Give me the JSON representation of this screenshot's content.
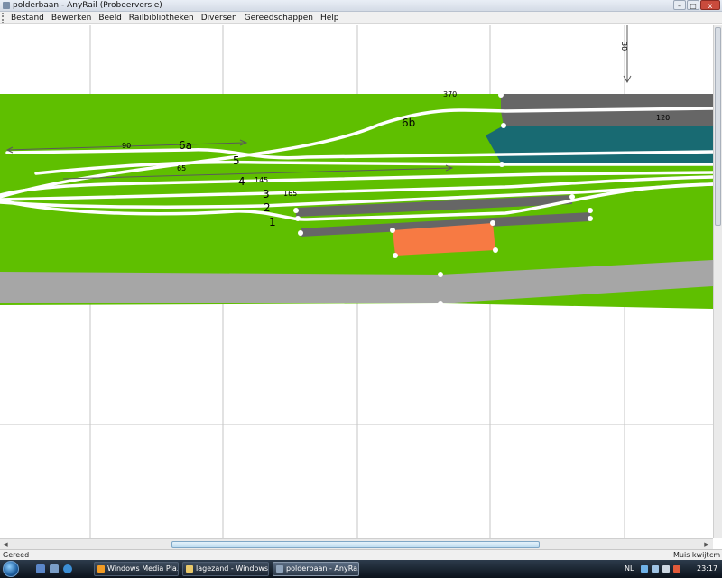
{
  "window": {
    "title": "polderbaan - AnyRail (Probeerversie)",
    "buttons": {
      "minimize": "–",
      "maximize": "□",
      "close": "x"
    }
  },
  "menu": [
    "Bestand",
    "Bewerken",
    "Beeld",
    "Railbibliotheken",
    "Diversen",
    "Gereedschappen",
    "Help"
  ],
  "layout_labels": {
    "dim_370": "370",
    "dim_120": "120",
    "dim_90": "90",
    "dim_65": "65",
    "dim_145": "145",
    "dim_165": "165",
    "dim_30": "30",
    "track_6a": "6a",
    "track_6b": "6b",
    "track_5": "5",
    "track_4": "4",
    "track_3": "3",
    "track_2": "2",
    "track_1": "1"
  },
  "colors": {
    "grass": "#5fbf00",
    "road": "#a6a6a6",
    "platform": "#666666",
    "water": "#186a72",
    "building": "#f77a43",
    "track": "#ffffff",
    "grid": "#c6c6c6"
  },
  "statusbar": {
    "left": "Gereed",
    "mouse": "Muis kwijt",
    "unit": "cm"
  },
  "taskbar": {
    "tasks": [
      "Windows Media Pla...",
      "lagezand - Windows...",
      "polderbaan - AnyRa..."
    ],
    "lang": "NL",
    "time": "23:17"
  }
}
